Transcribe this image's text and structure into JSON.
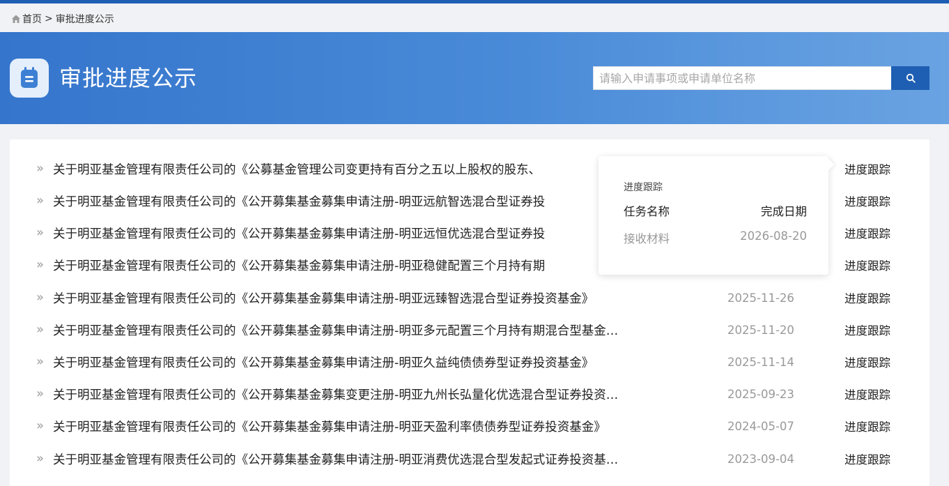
{
  "breadcrumb": {
    "home_label": "首页",
    "separator": ">",
    "current_label": "审批进度公示"
  },
  "header": {
    "title": "审批进度公示",
    "search_placeholder": "请输入申请事项或申请单位名称",
    "search_value": ""
  },
  "list": [
    {
      "title": "关于明亚基金管理有限责任公司的《公募基金管理公司变更持有百分之五以上股权的股东、",
      "date": "",
      "action": "进度跟踪"
    },
    {
      "title": "关于明亚基金管理有限责任公司的《公开募集基金募集申请注册-明亚远航智选混合型证券投",
      "date": "",
      "action": "进度跟踪"
    },
    {
      "title": "关于明亚基金管理有限责任公司的《公开募集基金募集申请注册-明亚远恒优选混合型证券投",
      "date": "",
      "action": "进度跟踪"
    },
    {
      "title": "关于明亚基金管理有限责任公司的《公开募集基金募集申请注册-明亚稳健配置三个月持有期",
      "date": "",
      "action": "进度跟踪"
    },
    {
      "title": "关于明亚基金管理有限责任公司的《公开募集基金募集申请注册-明亚远臻智选混合型证券投资基金》",
      "date": "2025-11-26",
      "action": "进度跟踪"
    },
    {
      "title": "关于明亚基金管理有限责任公司的《公开募集基金募集申请注册-明亚多元配置三个月持有期混合型基金…",
      "date": "2025-11-20",
      "action": "进度跟踪"
    },
    {
      "title": "关于明亚基金管理有限责任公司的《公开募集基金募集申请注册-明亚久益纯债债券型证券投资基金》",
      "date": "2025-11-14",
      "action": "进度跟踪"
    },
    {
      "title": "关于明亚基金管理有限责任公司的《公开募集基金募集变更注册-明亚九州长弘量化优选混合型证券投资…",
      "date": "2025-09-23",
      "action": "进度跟踪"
    },
    {
      "title": "关于明亚基金管理有限责任公司的《公开募集基金募集申请注册-明亚天盈利率债债券型证券投资基金》",
      "date": "2024-05-07",
      "action": "进度跟踪"
    },
    {
      "title": "关于明亚基金管理有限责任公司的《公开募集基金募集申请注册-明亚消费优选混合型发起式证券投资基…",
      "date": "2023-09-04",
      "action": "进度跟踪"
    }
  ],
  "popover": {
    "title": "进度跟踪",
    "col_name": "任务名称",
    "col_date": "完成日期",
    "rows": [
      {
        "name": "接收材料",
        "date": "2026-08-20"
      }
    ]
  },
  "colors": {
    "brand": "#1e5fb3",
    "banner_start": "#3575cc",
    "banner_end": "#6aa3e2"
  },
  "icons": {
    "home": "home-icon",
    "logo": "clipboard-icon",
    "search": "search-icon",
    "arrow": "double-chevron-right-icon"
  }
}
